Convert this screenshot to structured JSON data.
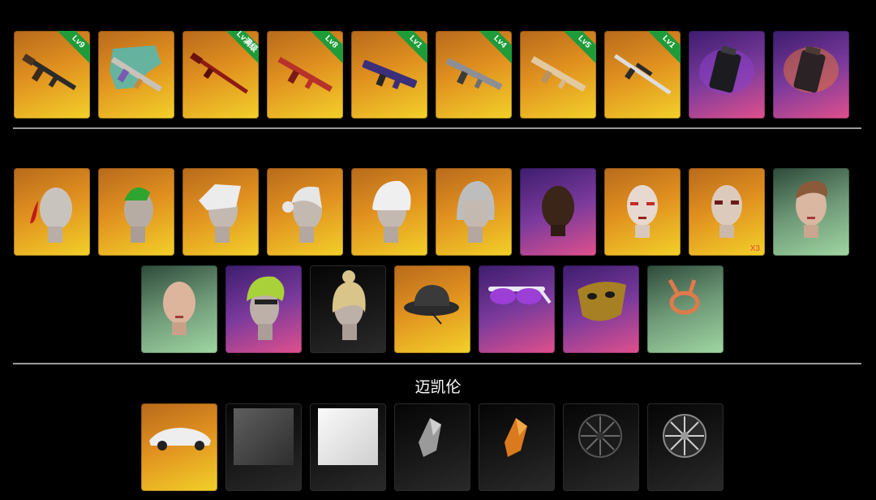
{
  "weapons": [
    {
      "icon": "rifle-akm-icon",
      "tier": "gold",
      "level": "Lv9"
    },
    {
      "icon": "rifle-camo-icon",
      "tier": "gold",
      "level": ""
    },
    {
      "icon": "rifle-red-icon",
      "tier": "gold",
      "level": "Lv满级"
    },
    {
      "icon": "rifle-m416-icon",
      "tier": "gold",
      "level": "Lv8"
    },
    {
      "icon": "smg-purple-icon",
      "tier": "gold",
      "level": "Lv1"
    },
    {
      "icon": "rifle-silver-icon",
      "tier": "gold",
      "level": "Lv4"
    },
    {
      "icon": "rifle-gold-icon",
      "tier": "gold",
      "level": "Lv5"
    },
    {
      "icon": "sniper-rifle-icon",
      "tier": "gold",
      "level": "Lv1"
    },
    {
      "icon": "smoke-grenade-icon",
      "tier": "purple",
      "level": ""
    },
    {
      "icon": "frag-grenade-icon",
      "tier": "purple",
      "level": ""
    }
  ],
  "appearance_row1": [
    {
      "icon": "ponytail-hair-icon",
      "tier": "gold"
    },
    {
      "icon": "green-hair-icon",
      "tier": "gold"
    },
    {
      "icon": "white-spiky-hair-icon",
      "tier": "gold"
    },
    {
      "icon": "white-bun-hair-icon",
      "tier": "gold"
    },
    {
      "icon": "white-shag-hair-icon",
      "tier": "gold"
    },
    {
      "icon": "gray-bob-hair-icon",
      "tier": "gold"
    },
    {
      "icon": "bald-dark-face-icon",
      "tier": "purple"
    },
    {
      "icon": "face-paint-female-icon",
      "tier": "gold"
    },
    {
      "icon": "face-paint-male-icon",
      "tier": "gold",
      "qty": "X3"
    },
    {
      "icon": "female-face-icon",
      "tier": "green"
    }
  ],
  "appearance_row2": [
    {
      "icon": "bald-female-face-icon",
      "tier": "green"
    },
    {
      "icon": "lime-hair-icon",
      "tier": "purple"
    },
    {
      "icon": "blonde-bun-hair-icon",
      "tier": "dark"
    },
    {
      "icon": "bucket-hat-icon",
      "tier": "gold"
    },
    {
      "icon": "sunglasses-icon",
      "tier": "purple"
    },
    {
      "icon": "gold-mask-icon",
      "tier": "purple"
    },
    {
      "icon": "headband-icon",
      "tier": "green"
    }
  ],
  "vehicle_section": {
    "title": "迈凯伦",
    "items": [
      {
        "icon": "white-supercar-icon",
        "tier": "gold"
      },
      {
        "icon": "dark-paint-swatch-icon",
        "tier": "dark"
      },
      {
        "icon": "white-paint-swatch-icon",
        "tier": "dark"
      },
      {
        "icon": "silver-crystal-icon",
        "tier": "dark"
      },
      {
        "icon": "orange-crystal-icon",
        "tier": "dark"
      },
      {
        "icon": "black-wheel-icon",
        "tier": "dark"
      },
      {
        "icon": "silver-wheel-icon",
        "tier": "dark"
      }
    ]
  }
}
